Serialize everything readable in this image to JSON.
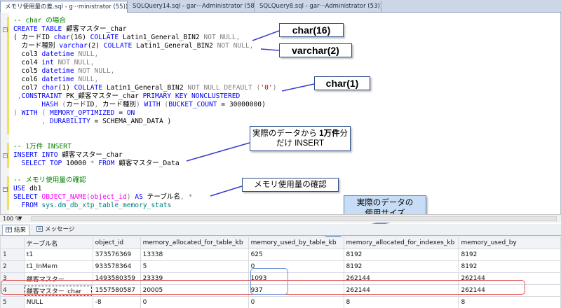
{
  "tabs": [
    {
      "label": "メモリ使用量の差.sql - g···ministrator (55))*",
      "close": "×"
    },
    {
      "label": "SQLQuery14.sql - gar···Administrator (58))*",
      "close": ""
    },
    {
      "label": "SQLQuery8.sql - gar···Administrator (53))*",
      "close": ""
    }
  ],
  "code": {
    "l1": {
      "t1": "-- char の場合"
    },
    "l2": {
      "t1": "CREATE TABLE",
      "t2": " 顧客マスター_char"
    },
    "l3": {
      "t1": "( カードID ",
      "t2": "char",
      "t3": "(16) ",
      "t4": "COLLATE",
      "t5": " Latin1_General_BIN2 ",
      "t6": "NOT NULL",
      "t7": ","
    },
    "l4": {
      "t1": "  カード種別 ",
      "t2": "varchar",
      "t3": "(2) ",
      "t4": "COLLATE",
      "t5": " Latin1_General_BIN2 ",
      "t6": "NOT NULL",
      "t7": ","
    },
    "l5": {
      "t1": "  col3 ",
      "t2": "datetime",
      "t3": " ",
      "t4": "NULL",
      "t5": ","
    },
    "l6": {
      "t1": "  col4 ",
      "t2": "int",
      "t3": " ",
      "t4": "NOT NULL",
      "t5": ","
    },
    "l7": {
      "t1": "  col5 ",
      "t2": "datetime",
      "t3": " ",
      "t4": "NOT NULL",
      "t5": ","
    },
    "l8": {
      "t1": "  col6 ",
      "t2": "datetime",
      "t3": " ",
      "t4": "NULL",
      "t5": ","
    },
    "l9": {
      "t1": "  col7 ",
      "t2": "char",
      "t3": "(1) ",
      "t4": "COLLATE",
      "t5": " Latin1_General_BIN2 ",
      "t6": "NOT NULL DEFAULT",
      "t7": " (",
      "t8": "'0'",
      "t9": ")"
    },
    "l10": {
      "t1": " ,",
      "t2": "CONSTRAINT",
      "t3": " PK_顧客マスター_char ",
      "t4": "PRIMARY KEY NONCLUSTERED"
    },
    "l11": {
      "t1": "       HASH",
      "t2": " (",
      "t3": "カードID",
      "t4": ", ",
      "t5": "カード種別",
      "t6": ") ",
      "t7": "WITH",
      "t8": " (",
      "t9": "BUCKET_COUNT",
      "t10": " = 30000000)"
    },
    "l12": {
      "t1": ") ",
      "t2": "WITH",
      "t3": " ( ",
      "t4": "MEMORY_OPTIMIZED",
      "t5": " = ",
      "t6": "ON"
    },
    "l13": {
      "t1": "       , ",
      "t2": "DURABILITY",
      "t3": " = SCHEMA_AND_DATA )"
    },
    "l14": {
      "t1": "-- 1万件 INSERT"
    },
    "l15": {
      "t1": "INSERT INTO",
      "t2": " 顧客マスター_char"
    },
    "l16": {
      "t1": "  SELECT TOP",
      "t2": " 10000 ",
      "t3": "*",
      "t4": " FROM",
      "t5": " 顧客マスター_Data"
    },
    "l17": {
      "t1": "-- メモリ使用量の確認"
    },
    "l18": {
      "t1": "USE",
      "t2": " db1"
    },
    "l19": {
      "t1": "SELECT",
      "t2": " OBJECT_NAME",
      "t3": "(",
      "t4": "object_id",
      "t5": ") ",
      "t6": "AS",
      "t7": " テーブル名",
      "t8": ", ",
      "t9": "*"
    },
    "l20": {
      "t1": "  FROM",
      "t2": " sys",
      "t3": ".",
      "t4": "dm_db_xtp_table_memory_stats"
    }
  },
  "callouts": {
    "c1": "char(16)",
    "c2": "varchar(2)",
    "c3": "char(1)",
    "c4_a": "実際のデータから",
    "c4_b": "1万件",
    "c4_c": "分",
    "c4_d": "だけ INSERT",
    "c5": "メモリ使用量の確認",
    "c6_a": "実際のデータの",
    "c6_b": "使用サイズ"
  },
  "zoom": "100 %",
  "results_tabs": [
    "結果",
    "メッセージ"
  ],
  "grid": {
    "columns": [
      "",
      "テーブル名",
      "object_id",
      "memory_allocated_for_table_kb",
      "memory_used_by_table_kb",
      "memory_allocated_for_indexes_kb",
      "memory_used_by"
    ],
    "rows": [
      [
        "1",
        "t1",
        "373576369",
        "13338",
        "625",
        "8192",
        "8192"
      ],
      [
        "2",
        "t1_InMem",
        "933578364",
        "5",
        "0",
        "8192",
        "8192"
      ],
      [
        "3",
        "顧客マスター",
        "1493580359",
        "23339",
        "1093",
        "262144",
        "262144"
      ],
      [
        "4",
        "顧客マスター_char",
        "1557580587",
        "20005",
        "937",
        "262144",
        "262144"
      ],
      [
        "5",
        "NULL",
        "-8",
        "0",
        "0",
        "8",
        "8"
      ]
    ]
  }
}
